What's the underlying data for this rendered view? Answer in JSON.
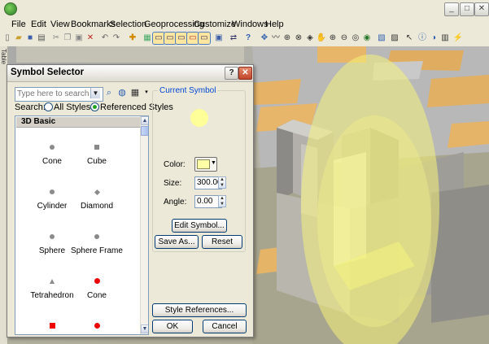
{
  "window": {
    "app_icon": "globe-icon",
    "controls": {
      "minimize": "_",
      "maximize": "□",
      "close": "✕"
    }
  },
  "menubar": [
    "File",
    "Edit",
    "View",
    "Bookmarks",
    "Selection",
    "Geoprocessing",
    "Customize",
    "Windows",
    "Help"
  ],
  "side_panel": {
    "label": "Table"
  },
  "dialog": {
    "title": "Symbol Selector",
    "help_button": "?",
    "close_button": "✕",
    "search": {
      "placeholder": "Type here to search",
      "label": "Search:",
      "options": [
        "All Styles",
        "Referenced Styles"
      ],
      "selected": "Referenced Styles"
    },
    "category": "3D Basic",
    "symbols": [
      {
        "label": "Cone",
        "icon": "dot"
      },
      {
        "label": "Cube",
        "icon": "square"
      },
      {
        "label": "Cylinder",
        "icon": "dot"
      },
      {
        "label": "Diamond",
        "icon": "diamond"
      },
      {
        "label": "Sphere",
        "icon": "dot"
      },
      {
        "label": "Sphere Frame",
        "icon": "dot"
      },
      {
        "label": "Tetrahedron",
        "icon": "triangle"
      },
      {
        "label": "Cone",
        "icon": "red-dot"
      },
      {
        "label": "",
        "icon": "red-square"
      },
      {
        "label": "",
        "icon": "red-dot"
      }
    ],
    "current_symbol": {
      "title": "Current Symbol",
      "preview_color": "#ffff99",
      "color_label": "Color:",
      "color_value": "#ffffa8",
      "size_label": "Size:",
      "size_value": "300.00",
      "angle_label": "Angle:",
      "angle_value": "0.00"
    },
    "buttons": {
      "edit_symbol": "Edit Symbol...",
      "save_as": "Save As...",
      "reset": "Reset",
      "style_references": "Style References...",
      "ok": "OK",
      "cancel": "Cancel"
    }
  },
  "colors": {
    "accent": "#0046d5",
    "highlight": "#ffff99",
    "dialog_bg": "#ece9d8"
  }
}
